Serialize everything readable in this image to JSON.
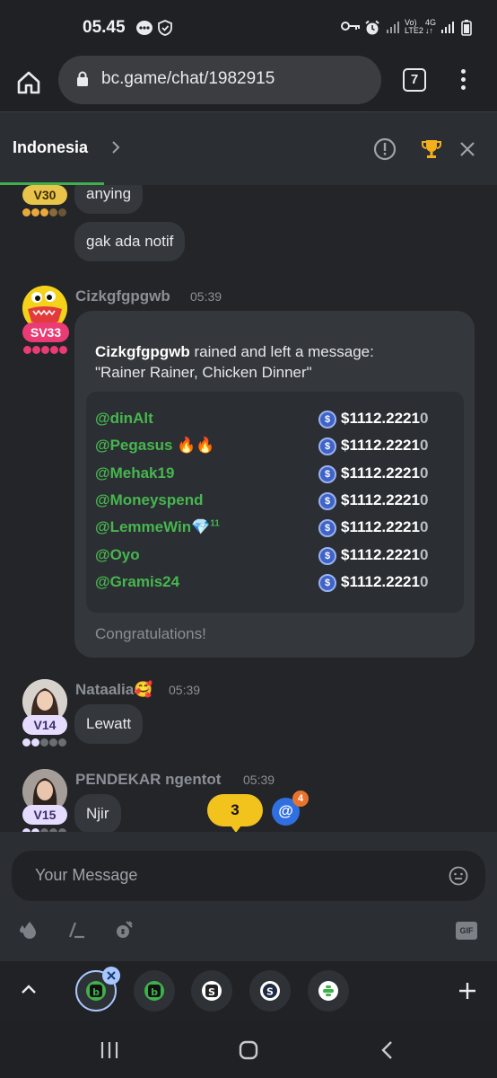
{
  "status_bar": {
    "time": "05.45",
    "network": "LTE2",
    "signal_label": "4G"
  },
  "browser": {
    "url": "bc.game/chat/1982915",
    "tab_count": "7"
  },
  "chat_header": {
    "room": "Indonesia"
  },
  "messages": {
    "first": {
      "vip": "V30",
      "lines": [
        "anying",
        "gak ada notif"
      ]
    },
    "rain": {
      "user": "Cizkgfgpgwb",
      "time": "05:39",
      "vip": "SV33",
      "headline_user": "Cizkgfgpgwb",
      "headline_text": " rained and left a message:",
      "quote": "\"Rainer Rainer, Chicken Dinner\"",
      "recipients": [
        {
          "name": "@dinAlt",
          "amount": "$1112.2221",
          "tail": "0"
        },
        {
          "name": "@Pegasus 🔥🔥",
          "amount": "$1112.2221",
          "tail": "0"
        },
        {
          "name": "@Mehak19",
          "amount": "$1112.2221",
          "tail": "0"
        },
        {
          "name": "@Moneyspend",
          "amount": "$1112.2221",
          "tail": "0"
        },
        {
          "name": "@LemmeWin💎",
          "sup": "11",
          "amount": "$1112.2221",
          "tail": "0"
        },
        {
          "name": "@Oyo",
          "amount": "$1112.2221",
          "tail": "0"
        },
        {
          "name": "@Gramis24",
          "amount": "$1112.2221",
          "tail": "0"
        }
      ],
      "footer": "Congratulations!"
    },
    "nataalia": {
      "user": "Nataalia🥰",
      "time": "05:39",
      "vip": "V14",
      "text": "Lewatt"
    },
    "pendekar": {
      "user": "PENDEKAR ngentot",
      "time": "05:39",
      "vip": "V15",
      "text": "Njir"
    }
  },
  "unread_badge": "3",
  "mention_badge": {
    "symbol": "@",
    "count": "4"
  },
  "composer": {
    "placeholder": "Your Message",
    "gif_label": "GIF"
  },
  "colors": {
    "accent_green": "#47b64f",
    "bg": "#232528",
    "bubble": "#34373c",
    "badge_yellow": "#f2c31d"
  }
}
